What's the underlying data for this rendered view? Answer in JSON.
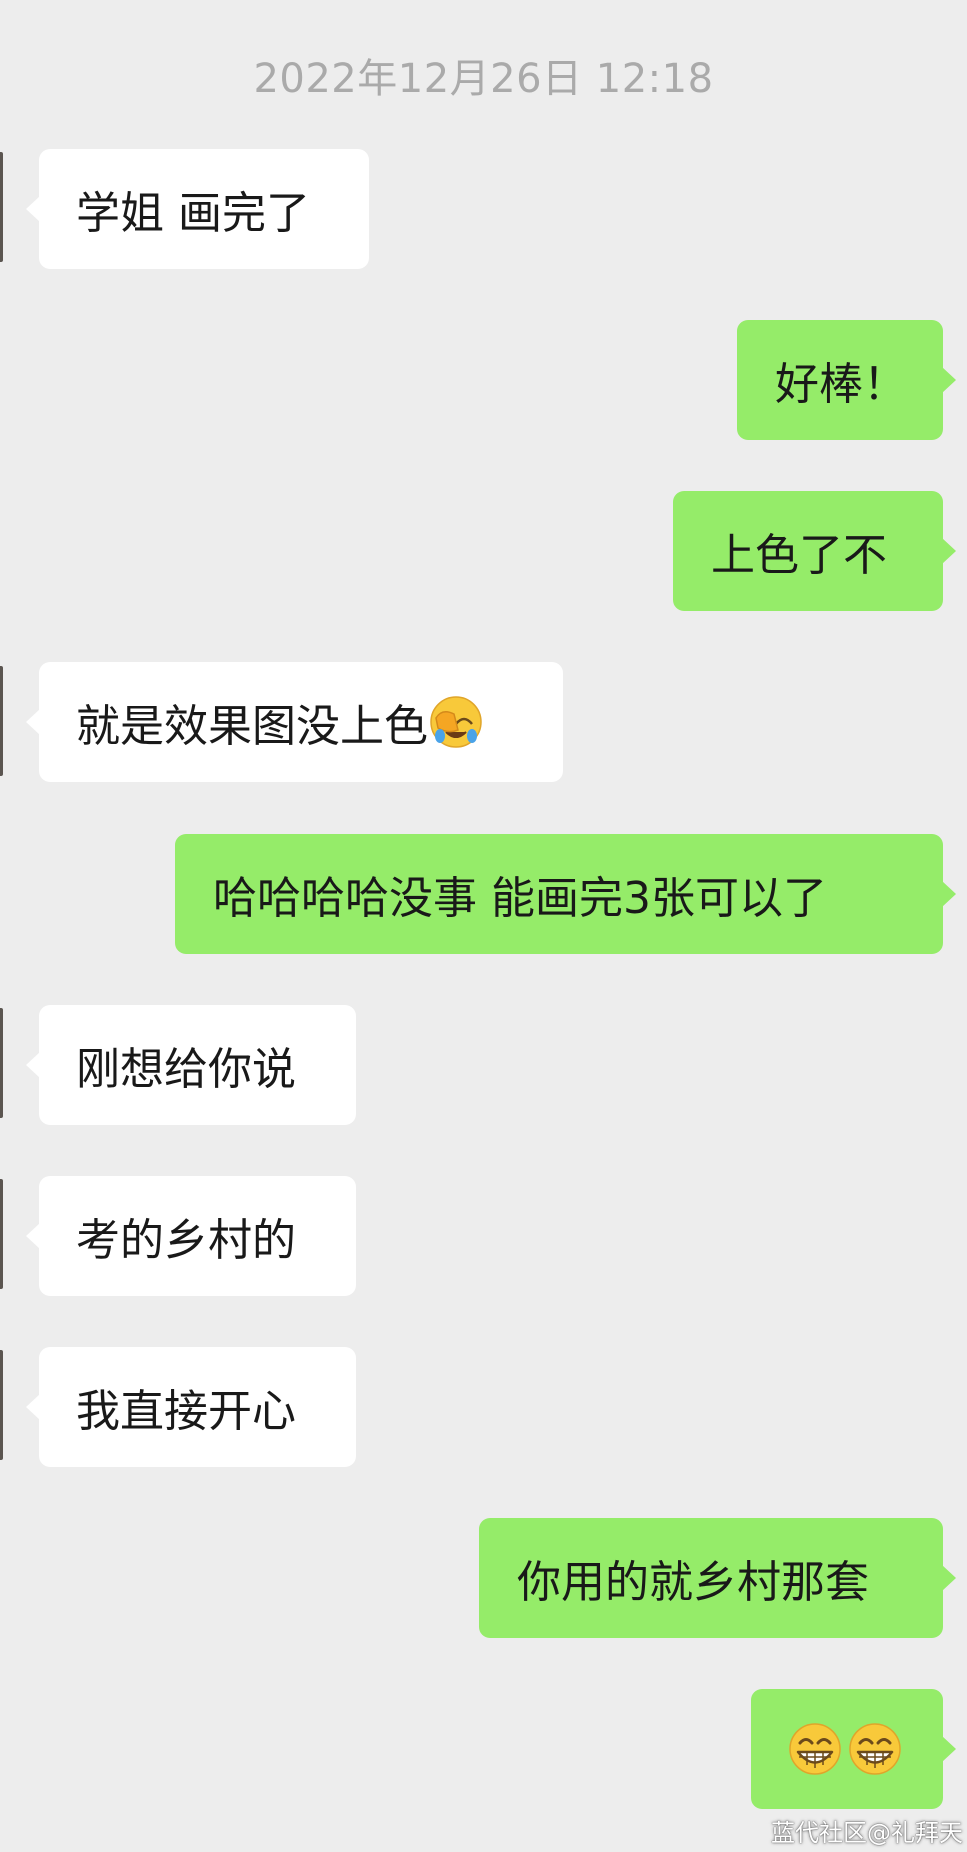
{
  "chat": {
    "timestamp": "2022年12月26日 12:18",
    "messages": [
      {
        "side": "in",
        "text": "学姐 画完了"
      },
      {
        "side": "out",
        "text": "好棒！"
      },
      {
        "side": "out",
        "text": "上色了不"
      },
      {
        "side": "in",
        "text": "就是效果图没上色",
        "emoji": "facepalm-laughing-emoji"
      },
      {
        "side": "out",
        "text": "哈哈哈哈没事 能画完3张可以了"
      },
      {
        "side": "in",
        "text": "刚想给你说"
      },
      {
        "side": "in",
        "text": "考的乡村的"
      },
      {
        "side": "in",
        "text": "我直接开心"
      },
      {
        "side": "out",
        "text": "你用的就乡村那套"
      },
      {
        "side": "out",
        "text": "",
        "emoji": "grinning-emoji x2"
      }
    ]
  },
  "watermark": "蓝代社区@礼拜天",
  "colors": {
    "background": "#ededed",
    "incoming_bubble": "#ffffff",
    "outgoing_bubble": "#95ec69",
    "timestamp": "#aaaaaa",
    "text": "#191919"
  }
}
